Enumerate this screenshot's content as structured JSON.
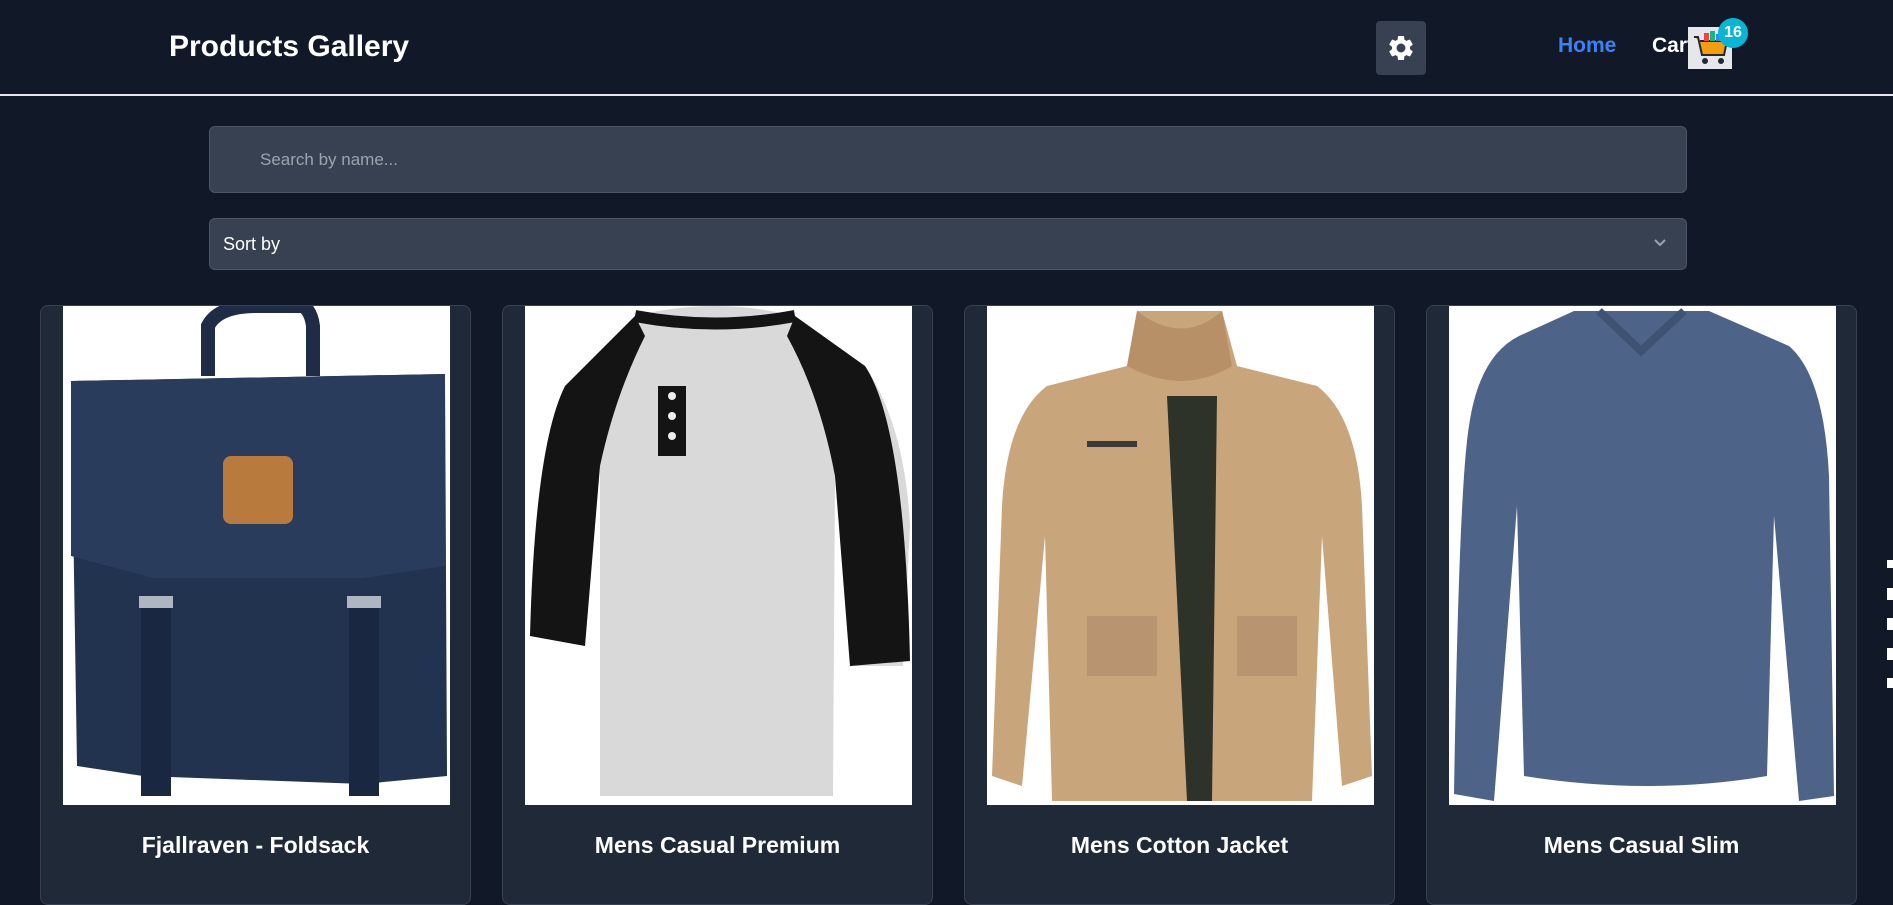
{
  "navbar": {
    "title": "Products Gallery",
    "home_label": "Home",
    "cart_label": "Cart",
    "cart_count": "16",
    "settings_icon": "gear-icon",
    "cart_icon": "shopping-cart-icon"
  },
  "search": {
    "placeholder": "Search by name...",
    "value": ""
  },
  "sort": {
    "selected": "Sort by"
  },
  "products": [
    {
      "name": "Fjallraven - Foldsack",
      "image": "navy-backpack"
    },
    {
      "name": "Mens Casual Premium",
      "image": "raglan-henley-tshirt"
    },
    {
      "name": "Mens Cotton Jacket",
      "image": "khaki-cotton-jacket"
    },
    {
      "name": "Mens Casual Slim",
      "image": "blue-long-sleeve-tshirt"
    }
  ],
  "colors": {
    "background": "#111827",
    "card": "#1f2937",
    "input": "#374151",
    "link_active": "#3b82f6",
    "badge": "#06b6d4"
  }
}
